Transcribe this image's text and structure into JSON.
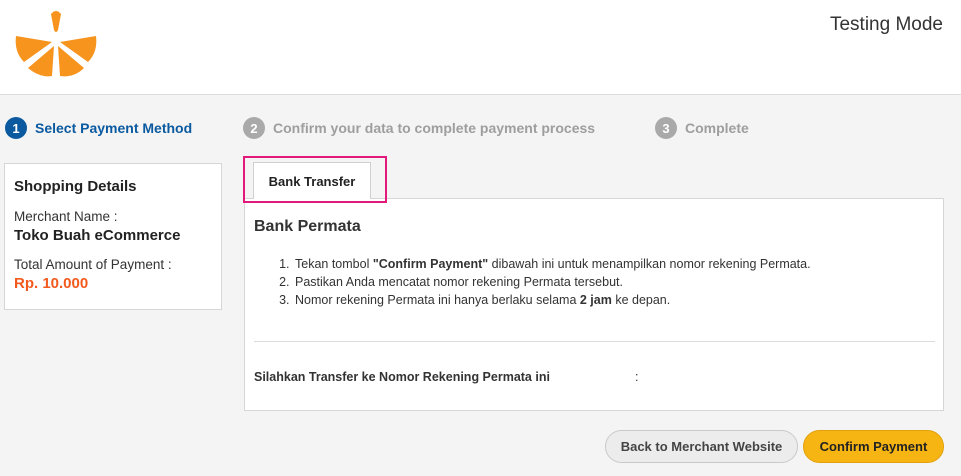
{
  "header": {
    "logo_icon": "orange-slice-logo",
    "mode": "Testing Mode"
  },
  "colors": {
    "accent_blue": "#0b5aa0",
    "orange": "#f7941d",
    "amount_red": "#f25a1d",
    "highlight_pink": "#e2187a",
    "button_yellow": "#f7b514"
  },
  "steps": [
    {
      "number": "1",
      "label": "Select Payment Method",
      "state": "active"
    },
    {
      "number": "2",
      "label": "Confirm your data to complete payment process",
      "state": "inactive"
    },
    {
      "number": "3",
      "label": "Complete",
      "state": "inactive"
    }
  ],
  "shopping": {
    "title": "Shopping Details",
    "merchant_label": "Merchant Name :",
    "merchant_name": "Toko Buah eCommerce",
    "amount_label": "Total Amount of Payment :",
    "amount": "Rp. 10.000"
  },
  "tab": {
    "label": "Bank Transfer"
  },
  "bank": {
    "title": "Bank Permata",
    "instructions": [
      {
        "before": "Tekan tombol ",
        "bold": "\"Confirm Payment\"",
        "after": " dibawah ini untuk menampilkan nomor rekening Permata."
      },
      {
        "before": "Pastikan Anda mencatat nomor rekening Permata tersebut.",
        "bold": "",
        "after": ""
      },
      {
        "before": "Nomor rekening Permata ini hanya berlaku selama ",
        "bold": "2 jam",
        "after": " ke depan."
      }
    ],
    "transfer_label": "Silahkan Transfer ke Nomor Rekening Permata ini",
    "transfer_colon": ":"
  },
  "buttons": {
    "back": "Back to Merchant Website",
    "confirm": "Confirm Payment"
  }
}
